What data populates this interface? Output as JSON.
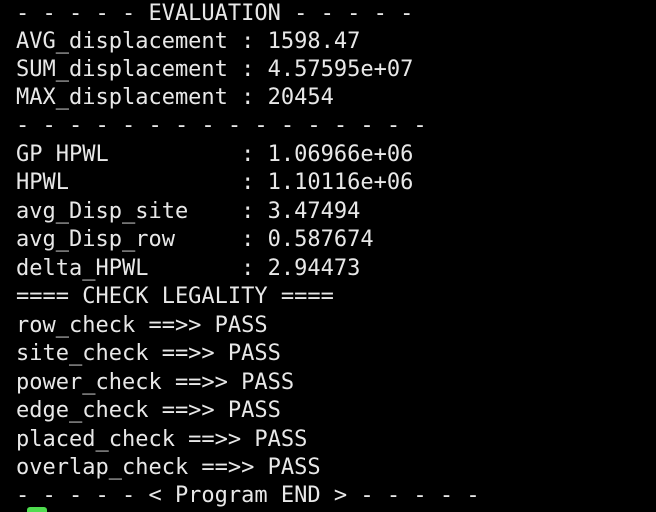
{
  "terminal": {
    "lines": [
      "- - - - - EVALUATION - - - - -",
      "AVG_displacement : 1598.47",
      "SUM_displacement : 4.57595e+07",
      "MAX_displacement : 20454",
      "- - - - - - - - - - - - - - - -",
      "GP HPWL          : 1.06966e+06",
      "HPWL             : 1.10116e+06",
      "avg_Disp_site    : 3.47494",
      "avg_Disp_row     : 0.587674",
      "delta_HPWL       : 2.94473",
      "==== CHECK LEGALITY ====",
      "row_check ==>> PASS",
      "site_check ==>> PASS",
      "power_check ==>> PASS",
      "edge_check ==>> PASS",
      "placed_check ==>> PASS",
      "overlap_check ==>> PASS",
      "- - - - - < Program END > - - - - -"
    ],
    "colors": {
      "background": "#000000",
      "text": "#e8e8e8",
      "cursor": "#4fdc4f"
    }
  }
}
